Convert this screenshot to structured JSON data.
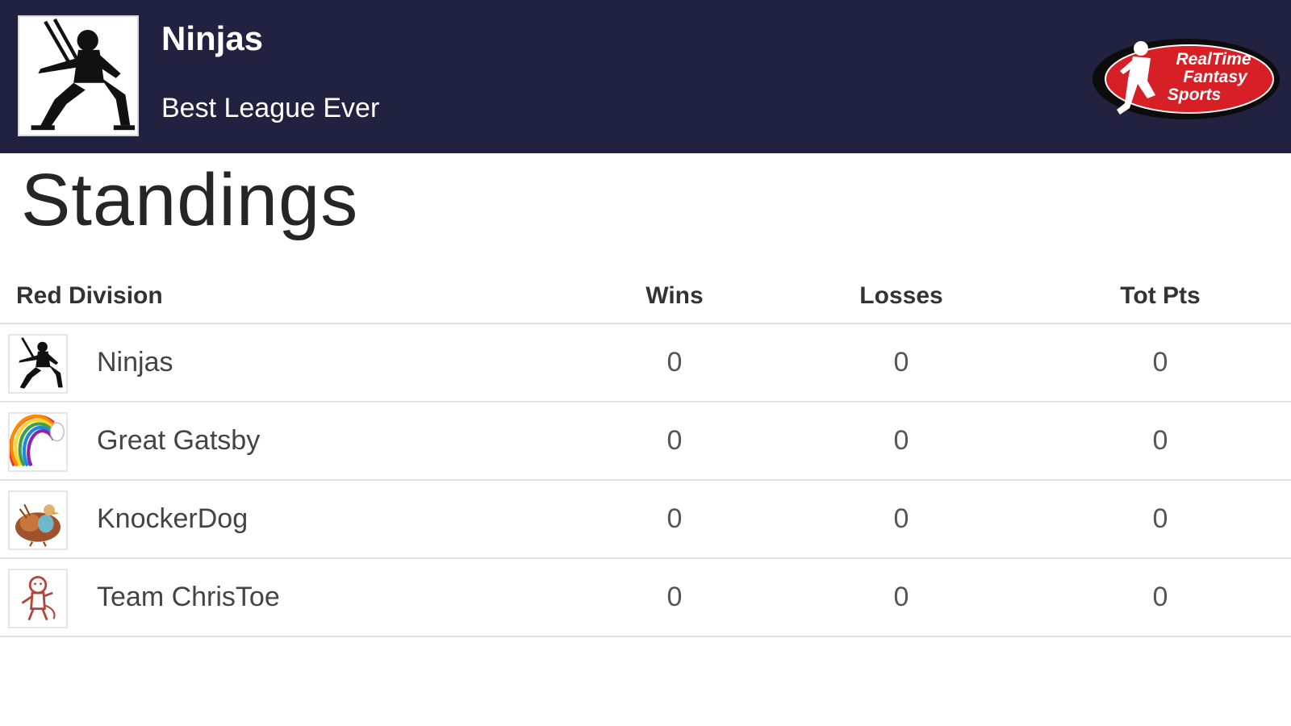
{
  "header": {
    "team_name": "Ninjas",
    "league_name": "Best League Ever",
    "team_icon": "ninja-icon",
    "brand_logo": {
      "lines": [
        "RealTime",
        "Fantasy",
        "Sports"
      ],
      "color": "#d71f26"
    },
    "background": "#20223f"
  },
  "page_title": "Standings",
  "table": {
    "division": "Red Division",
    "columns": [
      "Wins",
      "Losses",
      "Tot Pts"
    ],
    "rows": [
      {
        "team": "Ninjas",
        "icon": "ninja-icon",
        "wins": "0",
        "losses": "0",
        "tot_pts": "0"
      },
      {
        "team": "Great Gatsby",
        "icon": "rainbow-icon",
        "wins": "0",
        "losses": "0",
        "tot_pts": "0"
      },
      {
        "team": "KnockerDog",
        "icon": "turkey-icon",
        "wins": "0",
        "losses": "0",
        "tot_pts": "0"
      },
      {
        "team": "Team ChrisToe",
        "icon": "monkey-icon",
        "wins": "0",
        "losses": "0",
        "tot_pts": "0"
      }
    ]
  }
}
